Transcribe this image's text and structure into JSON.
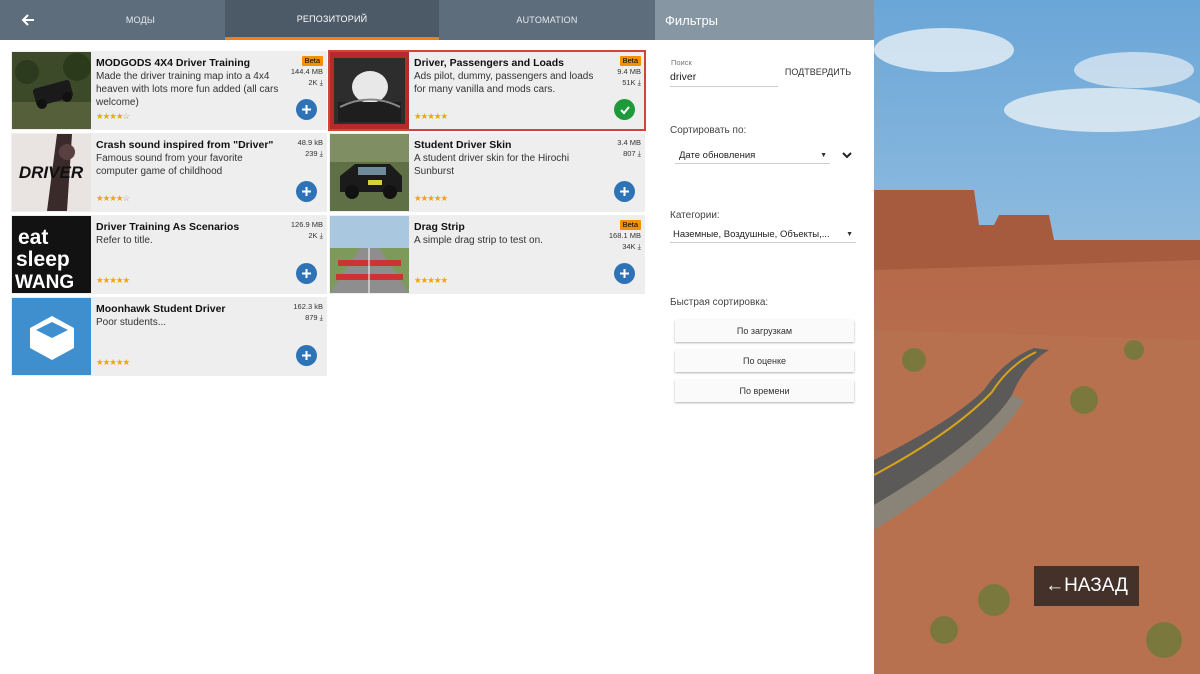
{
  "tabs": [
    {
      "label": "МОДЫ"
    },
    {
      "label": "РЕПОЗИТОРИЙ"
    },
    {
      "label": "AUTOMATION"
    }
  ],
  "mods": [
    {
      "title": "MODGODS 4X4 Driver Training",
      "desc": "Made the driver training map into a 4x4 heaven with lots more fun added (all cars welcome)",
      "beta": "Beta",
      "size": "144.4 MB",
      "downloads": "2K",
      "rating": 4.5,
      "status": "add"
    },
    {
      "title": "Driver, Passengers and Loads",
      "desc": "Ads pilot, dummy, passengers and loads for many vanilla and mods cars.",
      "beta": "Beta",
      "size": "9.4 MB",
      "downloads": "51K",
      "rating": 5,
      "status": "installed"
    },
    {
      "title": "Crash sound inspired from \"Driver\"",
      "desc": "Famous sound from your favorite computer game of childhood",
      "size": "48.9 kB",
      "downloads": "239",
      "rating": 4.5,
      "status": "add",
      "thumb_text": "DRIVER"
    },
    {
      "title": "Student Driver Skin",
      "desc": "A student driver skin for the Hirochi Sunburst",
      "size": "3.4 MB",
      "downloads": "807",
      "rating": 5,
      "status": "add"
    },
    {
      "title": "Driver Training As Scenarios",
      "desc": "Refer to title.",
      "size": "126.9 MB",
      "downloads": "2K",
      "rating": 5,
      "status": "add",
      "thumb_text": [
        "eat",
        "sleep",
        "WANG"
      ]
    },
    {
      "title": "Drag Strip",
      "desc": "A simple drag strip to test on.",
      "beta": "Beta",
      "size": "168.1 MB",
      "downloads": "34K",
      "rating": 5,
      "status": "add"
    },
    {
      "title": "Moonhawk Student Driver",
      "desc": "Poor students...",
      "size": "162.3 kB",
      "downloads": "879",
      "rating": 5,
      "status": "add"
    }
  ],
  "filters": {
    "title": "Фильтры",
    "search_label": "Поиск",
    "search_value": "driver",
    "confirm": "ПОДТВЕРДИТЬ",
    "sort_label": "Сортировать по:",
    "sort_value": "Дате обновления",
    "categories_label": "Категории:",
    "categories_value": "Наземные, Воздушные, Объекты,...",
    "quick_label": "Быстрая сортировка:",
    "quick": [
      "По загрузкам",
      "По оценке",
      "По времени"
    ]
  },
  "back_button": "←НАЗАД",
  "colors": {
    "topbar": "#5e6d7b",
    "active_tab": "#4c5a67",
    "accent": "#f07d1e",
    "add": "#2f73b7",
    "ok": "#1f9a3b",
    "beta": "#f39200"
  }
}
